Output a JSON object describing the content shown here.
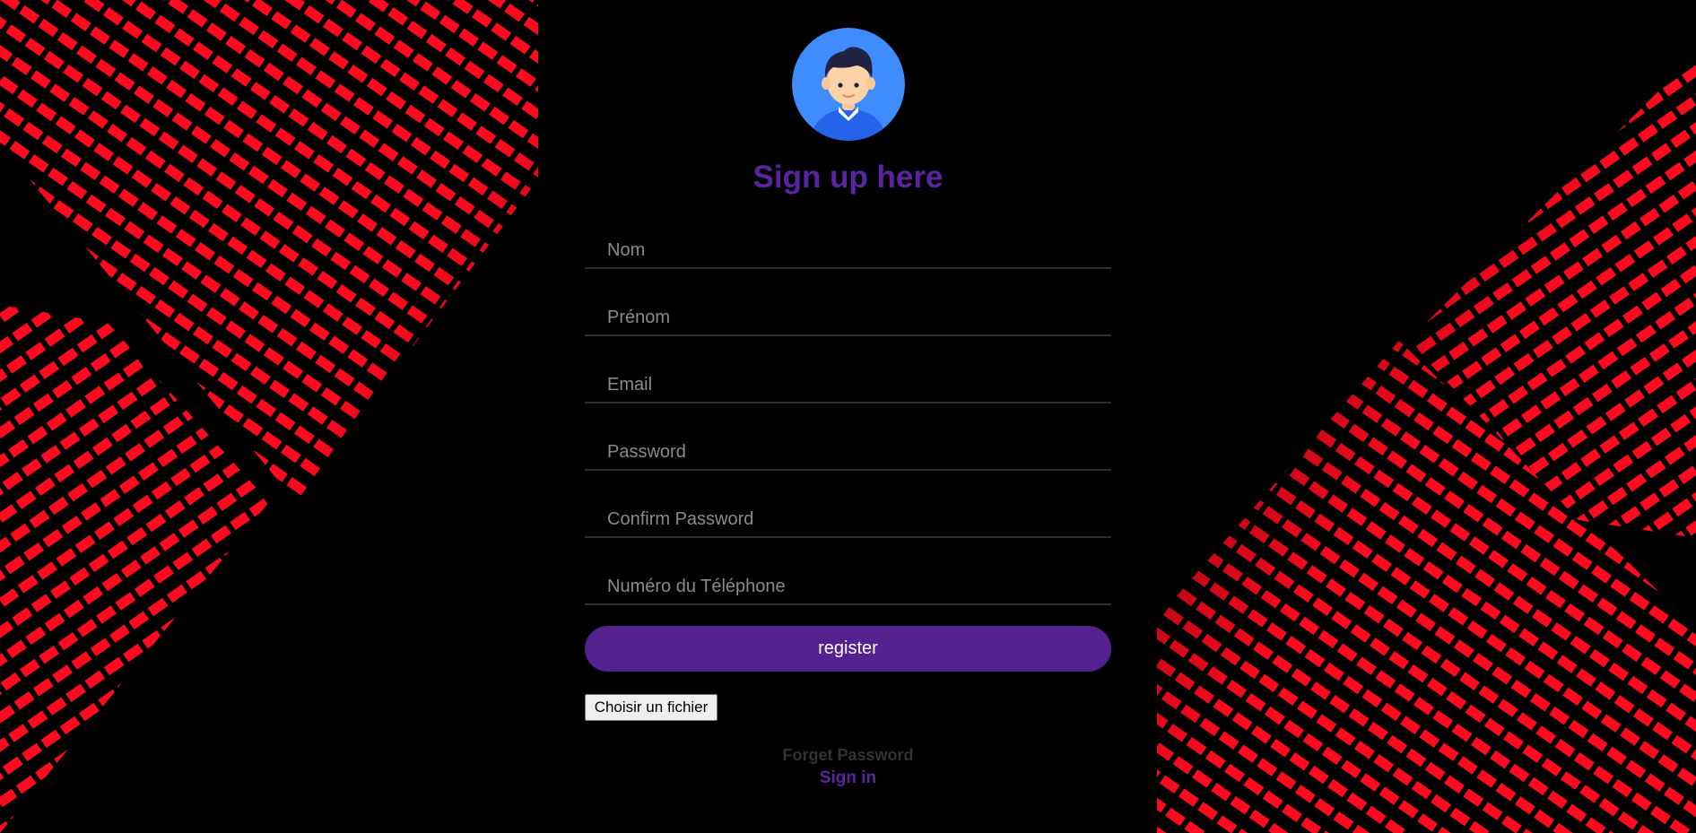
{
  "form": {
    "title": "Sign up here",
    "fields": [
      {
        "placeholder": "Nom",
        "value": ""
      },
      {
        "placeholder": "Prénom",
        "value": ""
      },
      {
        "placeholder": "Email",
        "value": ""
      },
      {
        "placeholder": "Password",
        "value": ""
      },
      {
        "placeholder": "Confirm Password",
        "value": ""
      },
      {
        "placeholder": "Numéro du Téléphone",
        "value": ""
      }
    ],
    "register_label": "register",
    "file_button_label": "Choisir un fichier",
    "forget_password_label": "Forget Password",
    "sign_in_label": "Sign in"
  },
  "avatar": {
    "icon": "user-avatar-icon"
  },
  "colors": {
    "accent": "#54218e",
    "title": "#5a24a0",
    "background": "#000000",
    "decor_red": "#ff0a1e",
    "avatar_bg": "#3f8cff"
  }
}
